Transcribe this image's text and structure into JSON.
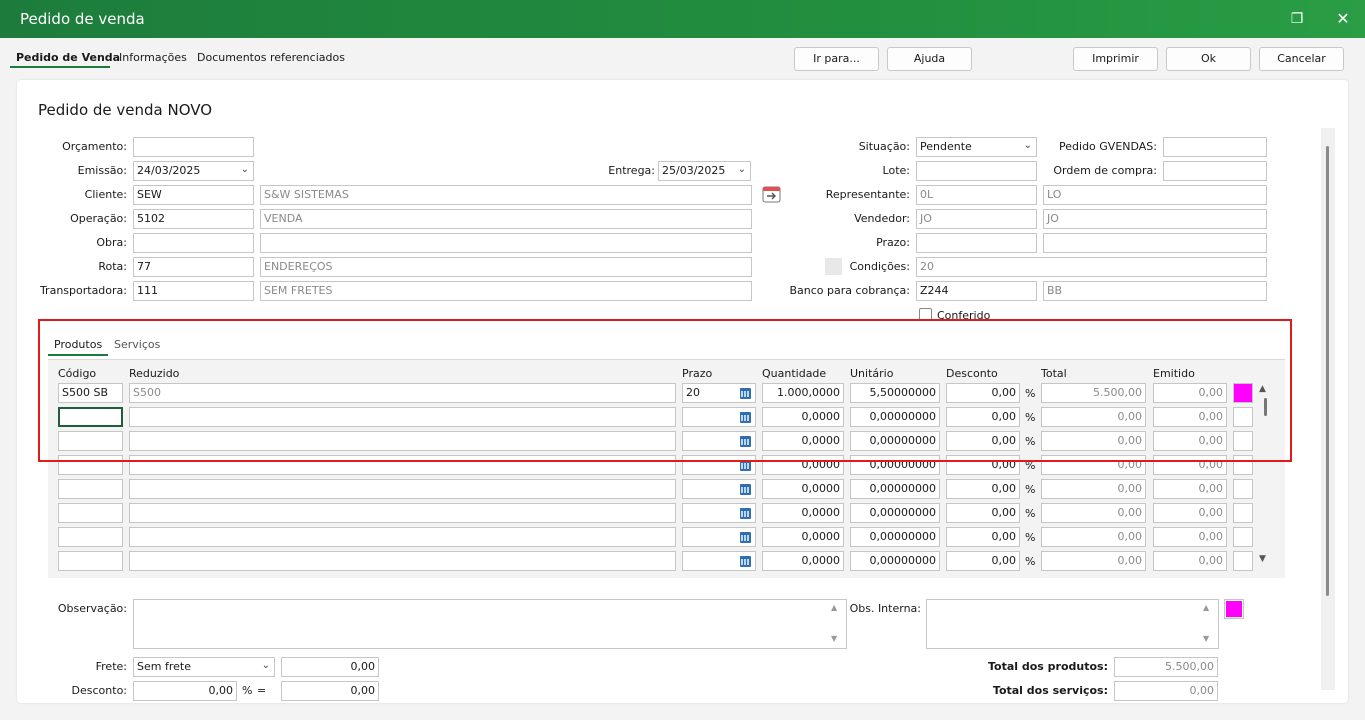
{
  "window": {
    "title": "Pedido de venda"
  },
  "top_tabs": [
    "Pedido de Venda",
    "Informações",
    "Documentos referenciados"
  ],
  "buttons": {
    "ir_para": "Ir para...",
    "ajuda": "Ajuda",
    "imprimir": "Imprimir",
    "ok": "Ok",
    "cancelar": "Cancelar"
  },
  "heading": "Pedido de venda NOVO",
  "left_form": {
    "orcamento": {
      "label": "Orçamento:",
      "value": ""
    },
    "emissao": {
      "label": "Emissão:",
      "value": "24/03/2025"
    },
    "entrega": {
      "label": "Entrega:",
      "value": "25/03/2025"
    },
    "cliente": {
      "label": "Cliente:",
      "code": "SEW",
      "name": "S&W SISTEMAS"
    },
    "operacao": {
      "label": "Operação:",
      "code": "5102",
      "name": "VENDA"
    },
    "obra": {
      "label": "Obra:",
      "code": "",
      "name": ""
    },
    "rota": {
      "label": "Rota:",
      "code": "77",
      "name": "ENDEREÇOS"
    },
    "transportadora": {
      "label": "Transportadora:",
      "code": "111",
      "name": "SEM FRETES"
    }
  },
  "right_form": {
    "situacao": {
      "label": "Situação:",
      "value": "Pendente"
    },
    "pedido_gvendas": {
      "label": "Pedido GVENDAS:",
      "value": ""
    },
    "lote": {
      "label": "Lote:",
      "value": ""
    },
    "ordem_compra": {
      "label": "Ordem de compra:",
      "value": ""
    },
    "representante": {
      "label": "Representante:",
      "code": "0L",
      "name": "LO"
    },
    "vendedor": {
      "label": "Vendedor:",
      "code": "JO",
      "name": "JO"
    },
    "prazo": {
      "label": "Prazo:",
      "code": "",
      "name": ""
    },
    "condicoes": {
      "label": "Condições:",
      "value": "20"
    },
    "banco": {
      "label": "Banco para cobrança:",
      "code": "Z244",
      "name": "BB"
    },
    "conferido": {
      "label": "Conferido"
    }
  },
  "item_tabs": [
    "Produtos",
    "Serviços"
  ],
  "grid": {
    "headers": [
      "Código",
      "Reduzido",
      "Prazo",
      "Quantidade",
      "Unitário",
      "Desconto",
      "Total",
      "Emitido"
    ],
    "rows": [
      {
        "codigo": "S500 SB",
        "reduzido": "S500",
        "prazo": "20",
        "quantidade": "1.000,0000",
        "unitario": "5,50000000",
        "desconto": "0,00",
        "pct": "%",
        "total": "5.500,00",
        "emitido": "0,00"
      },
      {
        "codigo": "",
        "reduzido": "",
        "prazo": "",
        "quantidade": "0,0000",
        "unitario": "0,00000000",
        "desconto": "0,00",
        "pct": "%",
        "total": "0,00",
        "emitido": "0,00"
      },
      {
        "codigo": "",
        "reduzido": "",
        "prazo": "",
        "quantidade": "0,0000",
        "unitario": "0,00000000",
        "desconto": "0,00",
        "pct": "%",
        "total": "0,00",
        "emitido": "0,00"
      },
      {
        "codigo": "",
        "reduzido": "",
        "prazo": "",
        "quantidade": "0,0000",
        "unitario": "0,00000000",
        "desconto": "0,00",
        "pct": "%",
        "total": "0,00",
        "emitido": "0,00"
      },
      {
        "codigo": "",
        "reduzido": "",
        "prazo": "",
        "quantidade": "0,0000",
        "unitario": "0,00000000",
        "desconto": "0,00",
        "pct": "%",
        "total": "0,00",
        "emitido": "0,00"
      },
      {
        "codigo": "",
        "reduzido": "",
        "prazo": "",
        "quantidade": "0,0000",
        "unitario": "0,00000000",
        "desconto": "0,00",
        "pct": "%",
        "total": "0,00",
        "emitido": "0,00"
      },
      {
        "codigo": "",
        "reduzido": "",
        "prazo": "",
        "quantidade": "0,0000",
        "unitario": "0,00000000",
        "desconto": "0,00",
        "pct": "%",
        "total": "0,00",
        "emitido": "0,00"
      },
      {
        "codigo": "",
        "reduzido": "",
        "prazo": "",
        "quantidade": "0,0000",
        "unitario": "0,00000000",
        "desconto": "0,00",
        "pct": "%",
        "total": "0,00",
        "emitido": "0,00"
      }
    ]
  },
  "bottom": {
    "observacao": {
      "label": "Observação:",
      "value": ""
    },
    "obs_interna": {
      "label": "Obs. Interna:",
      "value": ""
    },
    "frete": {
      "label": "Frete:",
      "value": "Sem frete",
      "amount": "0,00"
    },
    "desconto": {
      "label": "Desconto:",
      "value": "0,00",
      "pct": "%",
      "eq": "=",
      "amount": "0,00"
    },
    "total_produtos": {
      "label": "Total dos produtos:",
      "value": "5.500,00"
    },
    "total_servicos": {
      "label": "Total dos serviços:",
      "value": "0,00"
    }
  },
  "colors": {
    "title_bar": "#1d7c3c",
    "magenta": "#ff00ff",
    "highlight": "#e01b1b"
  },
  "icons": {
    "restore": "restore-icon",
    "close": "close-icon",
    "calendar": "calendar-icon",
    "dropdown": "chevron-down-icon"
  }
}
